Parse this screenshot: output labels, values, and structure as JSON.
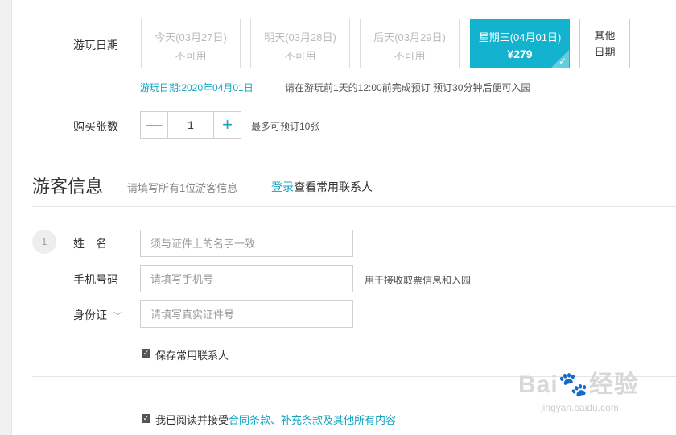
{
  "date": {
    "label": "游玩日期",
    "cards": [
      {
        "line1": "今天(03月27日)",
        "line2": "不可用"
      },
      {
        "line1": "明天(03月28日)",
        "line2": "不可用"
      },
      {
        "line1": "后天(03月29日)",
        "line2": "不可用"
      },
      {
        "line1": "星期三(04月01日)",
        "line2": "¥279"
      }
    ],
    "other_line1": "其他",
    "other_line2": "日期",
    "selected_text": "游玩日期:2020年04月01日",
    "booking_note": "请在游玩前1天的12:00前完成预订 预订30分钟后便可入园"
  },
  "quantity": {
    "label": "购买张数",
    "minus": "—",
    "value": "1",
    "plus": "+",
    "limit_note": "最多可预订10张"
  },
  "visitor": {
    "title": "游客信息",
    "subtitle": "请填写所有1位游客信息",
    "login_link": "登录",
    "login_suffix": "查看常用联系人",
    "index": "1",
    "name_label": "姓　名",
    "name_placeholder": "须与证件上的名字一致",
    "phone_label": "手机号码",
    "phone_placeholder": "请填写手机号",
    "phone_note": "用于接收取票信息和入园",
    "id_label": "身份证",
    "id_placeholder": "请填写真实证件号",
    "save_contact": "保存常用联系人"
  },
  "agreement": {
    "prefix": "我已阅读并接受",
    "link": "合同条款、补充条款及其他所有内容"
  },
  "watermark": {
    "brand": "Bai🐾经验",
    "url": "jingyan.baidu.com"
  },
  "colors": {
    "accent": "#13b3cf",
    "link": "#13a3bf"
  }
}
